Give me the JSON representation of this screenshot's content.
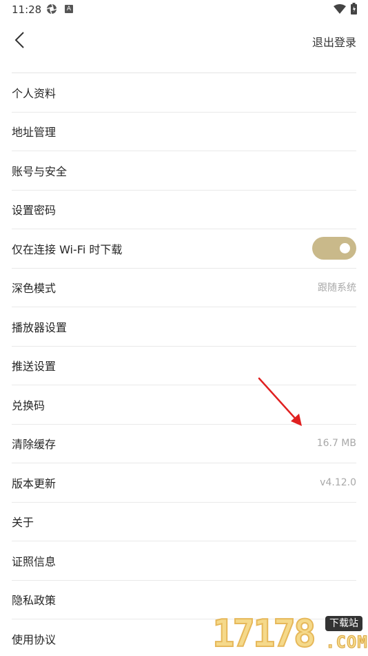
{
  "status_bar": {
    "time": "11:28",
    "badge_letter": "A"
  },
  "header": {
    "logout_label": "退出登录"
  },
  "settings": [
    {
      "label": "个人资料",
      "value": ""
    },
    {
      "label": "地址管理",
      "value": ""
    },
    {
      "label": "账号与安全",
      "value": ""
    },
    {
      "label": "设置密码",
      "value": ""
    },
    {
      "label": "仅在连接 Wi-Fi 时下载",
      "value": ""
    },
    {
      "label": "深色模式",
      "value": "跟随系统"
    },
    {
      "label": "播放器设置",
      "value": ""
    },
    {
      "label": "推送设置",
      "value": ""
    },
    {
      "label": "兑换码",
      "value": ""
    },
    {
      "label": "清除缓存",
      "value": "16.7 MB"
    },
    {
      "label": "版本更新",
      "value": "v4.12.0"
    },
    {
      "label": "关于",
      "value": ""
    },
    {
      "label": "证照信息",
      "value": ""
    },
    {
      "label": "隐私政策",
      "value": ""
    },
    {
      "label": "使用协议",
      "value": ""
    }
  ],
  "wifi_only_download": {
    "enabled": true,
    "accent_color": "#c9b98a"
  },
  "watermark": {
    "digits": "17178",
    "tag": "下载站",
    "domain": ".COM"
  },
  "annotation": {
    "arrow_color": "#e02020"
  }
}
